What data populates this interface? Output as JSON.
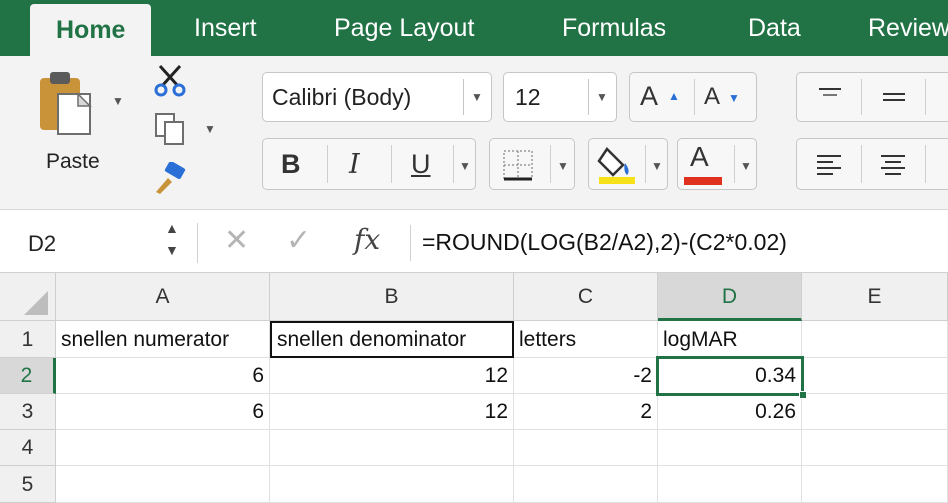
{
  "tabs": [
    {
      "label": "Home",
      "active": true
    },
    {
      "label": "Insert"
    },
    {
      "label": "Page Layout"
    },
    {
      "label": "Formulas"
    },
    {
      "label": "Data"
    },
    {
      "label": "Review"
    }
  ],
  "ribbon": {
    "paste_label": "Paste",
    "font_name": "Calibri (Body)",
    "font_size": "12",
    "bold": "B",
    "italic": "I",
    "underline": "U",
    "font_color_glyph": "A",
    "grow_font_glyph": "A",
    "shrink_font_glyph": "A",
    "highlight_color": "#f7e21a",
    "font_color": "#e0311f"
  },
  "formula_bar": {
    "name_box": "D2",
    "fx": "fx",
    "formula": "=ROUND(LOG(B2/A2),2)-(C2*0.02)"
  },
  "grid": {
    "columns": [
      "A",
      "B",
      "C",
      "D",
      "E"
    ],
    "rows": [
      "1",
      "2",
      "3",
      "4",
      "5"
    ],
    "selected_column": "D",
    "selected_row": "2",
    "cells": {
      "A1": "snellen numerator",
      "B1": "snellen denominator",
      "C1": "letters",
      "D1": "logMAR",
      "A2": "6",
      "B2": "12",
      "C2": "-2",
      "D2": "0.34",
      "A3": "6",
      "B3": "12",
      "C3": "2",
      "D3": "0.26"
    }
  },
  "colors": {
    "accent": "#217346"
  }
}
